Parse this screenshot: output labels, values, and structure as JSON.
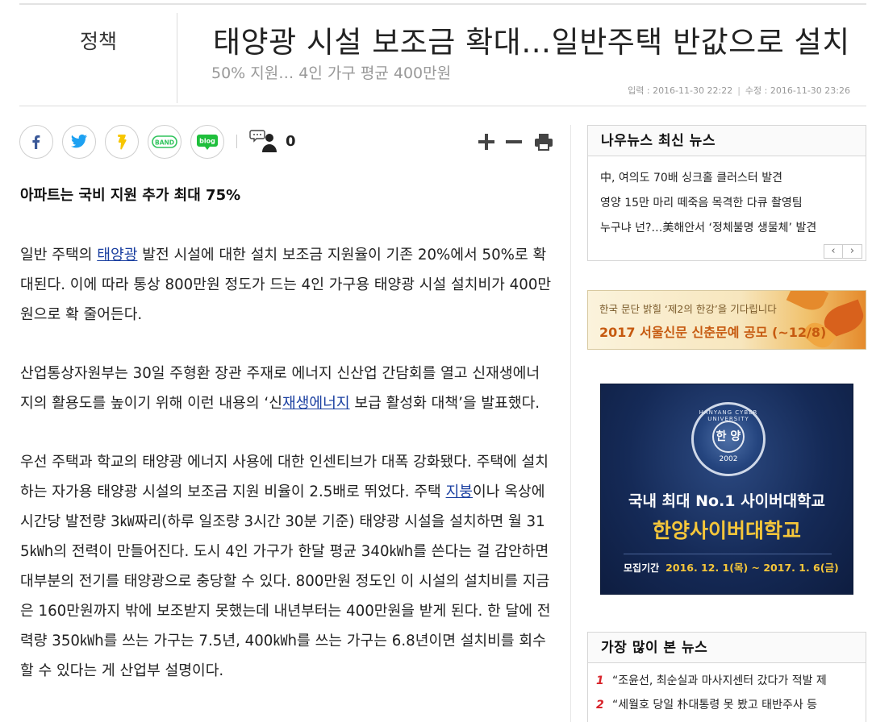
{
  "article": {
    "section": "정책",
    "headline": "태양광 시설 보조금 확대…일반주택 반값으로 설치",
    "subheadline": "50% 지원… 4인 가구 평균 400만원",
    "input_date": "입력 : 2016-11-30 22:22",
    "modified_date": "수정 : 2016-11-30 23:26",
    "comment_count": "0",
    "lead": "아파트는 국비 지원 추가 최대 75%",
    "p1": {
      "a": "일반 주택의 ",
      "link": "태양광",
      "b": " 발전 시설에 대한 설치 보조금 지원율이 기존 20%에서 50%로 확대된다. 이에 따라 통상 800만원 정도가 드는 4인 가구용 태양광 시설 설치비가 400만원으로 확 줄어든다."
    },
    "p2": {
      "a": "산업통상자원부는 30일 주형환 장관 주재로 에너지 신산업 간담회를 열고 신재생에너지의 활용도를 높이기 위해 이런 내용의 ‘신",
      "link": "재생에너지",
      "b": " 보급 활성화 대책’을 발표했다."
    },
    "p3": {
      "a": "우선 주택과 학교의 태양광 에너지 사용에 대한 인센티브가 대폭 강화됐다. 주택에 설치하는 자가용 태양광 시설의 보조금 지원 비율이 2.5배로 뛰었다. 주택 ",
      "link": "지붕",
      "b": "이나 옥상에 시간당 발전량 3㎾짜리(하루 일조량 3시간 30분 기준) 태양광 시설을 설치하면 월 315㎾h의 전력이 만들어진다. 도시 4인 가구가 한달 평균 340㎾h를 쓴다는 걸 감안하면 대부분의 전기를 태양광으로 충당할 수 있다. 800만원 정도인 이 시설의 설치비를 지금은 160만원까지 밖에 보조받지 못했는데 내년부터는 400만원을 받게 된다. 한 달에 전력량 350㎾h를 쓰는 가구는 7.5년, 400㎾h를 쓰는 가구는 6.8년이면 설치비를 회수할 수 있다는 게 산업부 설명이다."
    }
  },
  "share": {
    "band_label": "BAND",
    "blog_label": "blog"
  },
  "sidebar": {
    "latest_title": "나우뉴스 최신 뉴스",
    "latest_items": [
      "中, 여의도 70배 싱크홀 클러스터 발견",
      "영양 15만 마리 떼죽음 목격한 다큐 촬영팀",
      "누구냐 넌?…美해안서 ‘정체불명 생물체’ 발견"
    ],
    "pager_prev": "‹",
    "pager_next": "›",
    "banner1": {
      "line1": "한국 문단 밝힐 ‘제2의 한강’을 기다립니다",
      "line2": "2017 서울신문 신춘문예 공모 (~12/8)"
    },
    "banner2": {
      "emblem_text": "한 양",
      "emblem_ring": "HANYANG CYBER UNIVERSITY",
      "emblem_year": "2002",
      "line1": "국내 최대 No.1 사이버대학교",
      "line2": "한양사이버대학교",
      "period_label": "모집기간",
      "period_value": "2016. 12. 1(목) ~ 2017. 1. 6(금)"
    },
    "popular_title": "가장 많이 본 뉴스",
    "popular_items": [
      {
        "rank": "1",
        "text": "“조윤선, 최순실과 마사지센터 갔다가 적발 제"
      },
      {
        "rank": "2",
        "text": "“세월호 당일 朴대통령 못 봤고 태반주사 등"
      }
    ]
  },
  "colors": {
    "link": "#1a3fa0",
    "facebook": "#3b5998",
    "twitter": "#1da1f2",
    "kakao": "#f7c600",
    "band": "#31c45d",
    "blog": "#1fbf3c",
    "rank": "#d8232a"
  }
}
